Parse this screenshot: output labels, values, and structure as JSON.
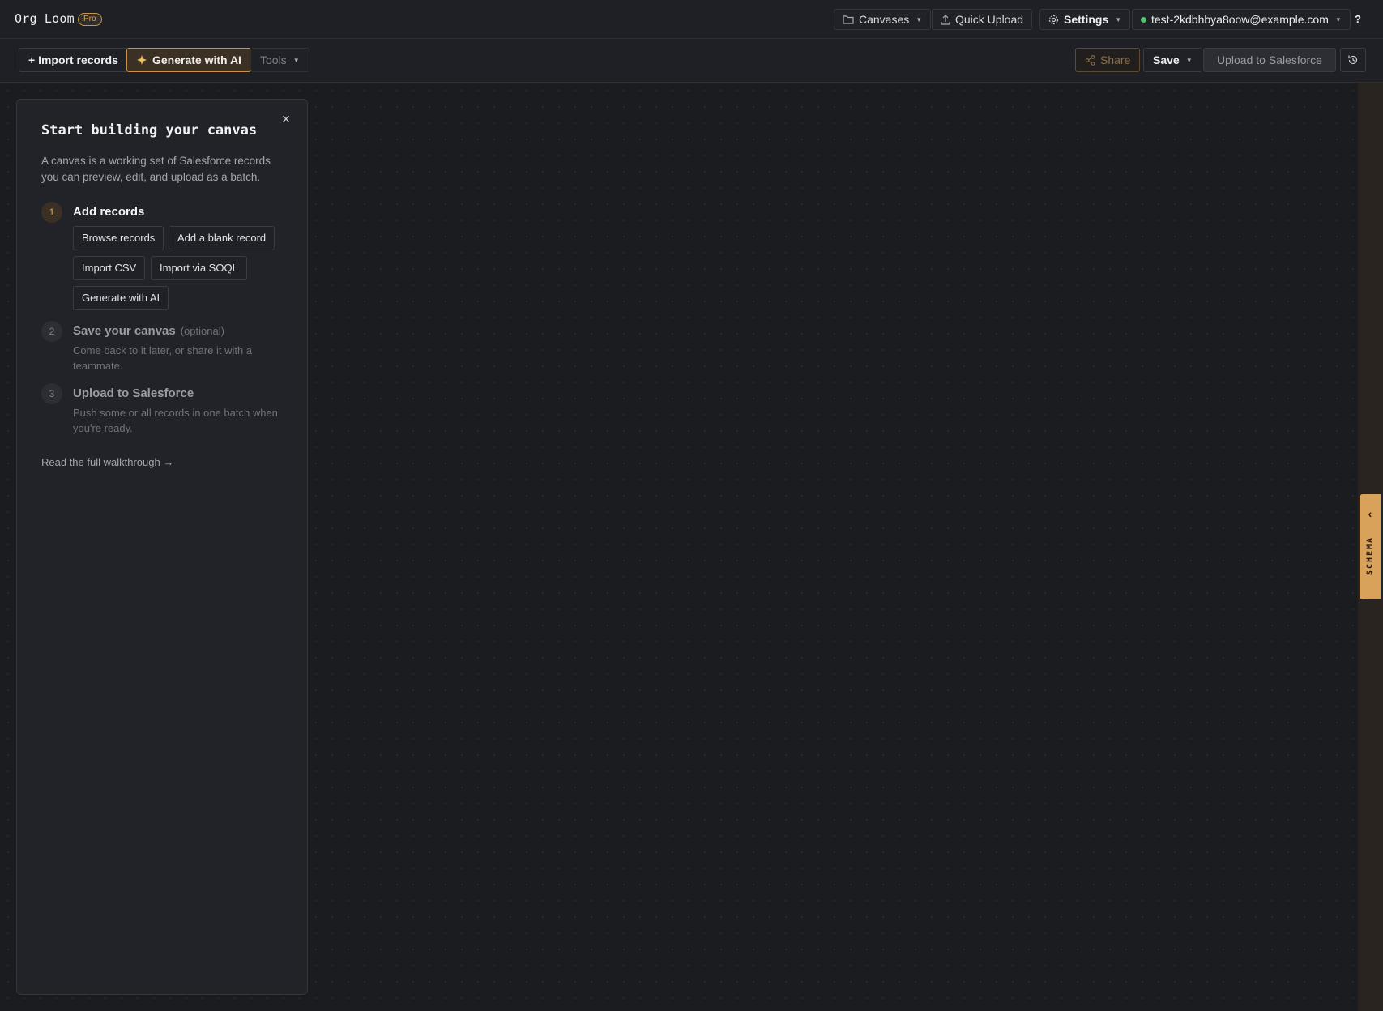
{
  "app": {
    "brand": "Org Loom",
    "badge": "Pro"
  },
  "topbar": {
    "canvases_label": "Canvases",
    "quick_upload_label": "Quick Upload",
    "settings_label": "Settings",
    "account_email": "test-2kdbhbya8oow@example.com",
    "help_label": "?"
  },
  "toolbar": {
    "import_label": "+ Import records",
    "generate_label": "Generate with AI",
    "tools_label": "Tools",
    "share_label": "Share",
    "save_label": "Save",
    "upload_label": "Upload to Salesforce"
  },
  "onboarding": {
    "close": "×",
    "title": "Start building your canvas",
    "description": "A canvas is a working set of Salesforce records you can preview, edit, and upload as a batch.",
    "steps": [
      {
        "number": "1",
        "title": "Add records",
        "actions": [
          "Browse records",
          "Add a blank record",
          "Import CSV",
          "Import via SOQL",
          "Generate with AI"
        ]
      },
      {
        "number": "2",
        "title": "Save your canvas",
        "optional": "(optional)",
        "description": "Come back to it later, or share it with a teammate."
      },
      {
        "number": "3",
        "title": "Upload to Salesforce",
        "description": "Push some or all records in one batch when you're ready."
      }
    ],
    "walkthrough_link": "Read the full walkthrough →"
  },
  "schema_tab": {
    "label": "SCHEMA"
  },
  "colors": {
    "accent": "#d9a25a",
    "background": "#1b1c20",
    "panel": "#212328",
    "status_online": "#4cc46a"
  },
  "icons": [
    "folder-icon",
    "upload-icon",
    "gear-icon",
    "sparkle-icon",
    "share-icon",
    "history-icon",
    "close-icon",
    "chevron-left-icon"
  ]
}
